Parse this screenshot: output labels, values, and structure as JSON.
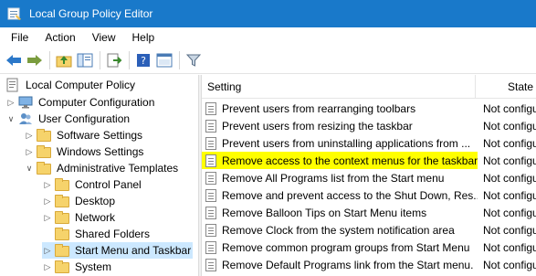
{
  "window": {
    "title": "Local Group Policy Editor",
    "icon": "gpedit-icon"
  },
  "menu": [
    "File",
    "Action",
    "View",
    "Help"
  ],
  "toolbar": {
    "buttons": [
      "back-arrow-icon",
      "forward-arrow-icon",
      "up-folder-icon",
      "show-hide-tree-icon",
      "export-list-icon",
      "help-icon",
      "properties-icon",
      "filter-icon"
    ]
  },
  "tree": {
    "root": "Local Computer Policy",
    "computer_config": "Computer Configuration",
    "user_config": "User Configuration",
    "software_settings": "Software Settings",
    "windows_settings": "Windows Settings",
    "admin_templates": "Administrative Templates",
    "control_panel": "Control Panel",
    "desktop": "Desktop",
    "network": "Network",
    "shared_folders": "Shared Folders",
    "start_menu": "Start Menu and Taskbar",
    "system": "System"
  },
  "list": {
    "header_setting": "Setting",
    "header_state": "State",
    "rows": [
      {
        "name": "Prevent users from rearranging toolbars",
        "state": "Not configured"
      },
      {
        "name": "Prevent users from resizing the taskbar",
        "state": "Not configured"
      },
      {
        "name": "Prevent users from uninstalling applications from ...",
        "state": "Not configured"
      },
      {
        "name": "Remove access to the context menus for the taskbar",
        "state": "Not configured",
        "highlighted": true
      },
      {
        "name": "Remove All Programs list from the Start menu",
        "state": "Not configured"
      },
      {
        "name": "Remove and prevent access to the Shut Down, Res...",
        "state": "Not configured"
      },
      {
        "name": "Remove Balloon Tips on Start Menu items",
        "state": "Not configured"
      },
      {
        "name": "Remove Clock from the system notification area",
        "state": "Not configured"
      },
      {
        "name": "Remove common program groups from Start Menu",
        "state": "Not configured"
      },
      {
        "name": "Remove Default Programs link from the Start menu.",
        "state": "Not configured"
      }
    ]
  }
}
